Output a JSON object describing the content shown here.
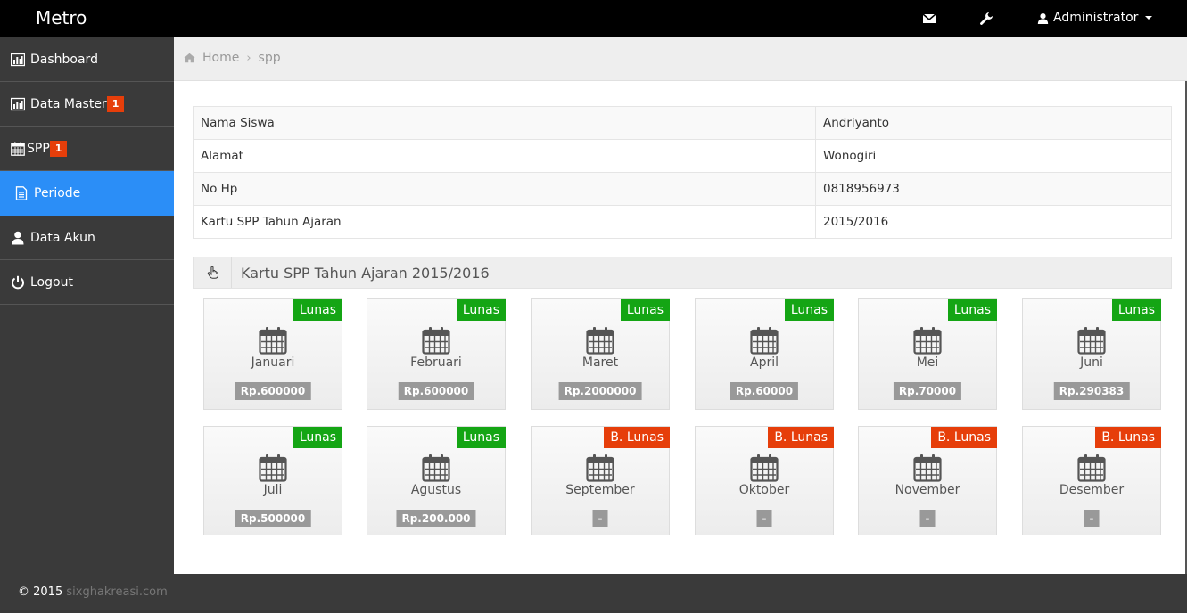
{
  "app": {
    "title": "Metro",
    "user": "Administrator"
  },
  "topbar": {
    "mail_icon": "envelope-icon",
    "tools_icon": "wrench-icon",
    "user_icon": "user-icon"
  },
  "sidebar": {
    "items": [
      {
        "label": "Dashboard",
        "icon": "bar-chart-icon",
        "badge": ""
      },
      {
        "label": "Data Master",
        "icon": "bar-chart-icon",
        "badge": "1"
      },
      {
        "label": "SPP",
        "icon": "calendar-icon",
        "badge": "1"
      },
      {
        "label": "Periode",
        "icon": "file-icon",
        "badge": "",
        "active": true
      },
      {
        "label": "Data Akun",
        "icon": "user-icon",
        "badge": ""
      },
      {
        "label": "Logout",
        "icon": "power-icon",
        "badge": ""
      }
    ]
  },
  "breadcrumb": {
    "home": "Home",
    "separator": "›",
    "current": "spp"
  },
  "student": {
    "rows": [
      {
        "label": "Nama Siswa",
        "value": "Andriyanto"
      },
      {
        "label": "Alamat",
        "value": "Wonogiri"
      },
      {
        "label": "No Hp",
        "value": "0818956973"
      },
      {
        "label": "Kartu SPP Tahun Ajaran",
        "value": "2015/2016"
      }
    ]
  },
  "panel": {
    "title": "Kartu SPP Tahun Ajaran 2015/2016",
    "icon": "hand-pointer-icon"
  },
  "months": [
    {
      "name": "Januari",
      "status": "Lunas",
      "amount": "Rp.600000",
      "paid": true
    },
    {
      "name": "Februari",
      "status": "Lunas",
      "amount": "Rp.600000",
      "paid": true
    },
    {
      "name": "Maret",
      "status": "Lunas",
      "amount": "Rp.2000000",
      "paid": true
    },
    {
      "name": "April",
      "status": "Lunas",
      "amount": "Rp.60000",
      "paid": true
    },
    {
      "name": "Mei",
      "status": "Lunas",
      "amount": "Rp.70000",
      "paid": true
    },
    {
      "name": "Juni",
      "status": "Lunas",
      "amount": "Rp.290383",
      "paid": true
    },
    {
      "name": "Juli",
      "status": "Lunas",
      "amount": "Rp.500000",
      "paid": true
    },
    {
      "name": "Agustus",
      "status": "Lunas",
      "amount": "Rp.200.000",
      "paid": true
    },
    {
      "name": "September",
      "status": "B. Lunas",
      "amount": "-",
      "paid": false
    },
    {
      "name": "Oktober",
      "status": "B. Lunas",
      "amount": "-",
      "paid": false
    },
    {
      "name": "November",
      "status": "B. Lunas",
      "amount": "-",
      "paid": false
    },
    {
      "name": "Desember",
      "status": "B. Lunas",
      "amount": "-",
      "paid": false
    }
  ],
  "footer": {
    "copyright": "© 2015",
    "link": "sixghakreasi.com"
  },
  "colors": {
    "accent": "#2b8ef7",
    "paid": "#14a514",
    "unpaid": "#e63e0a",
    "badge": "#e63e0a"
  }
}
